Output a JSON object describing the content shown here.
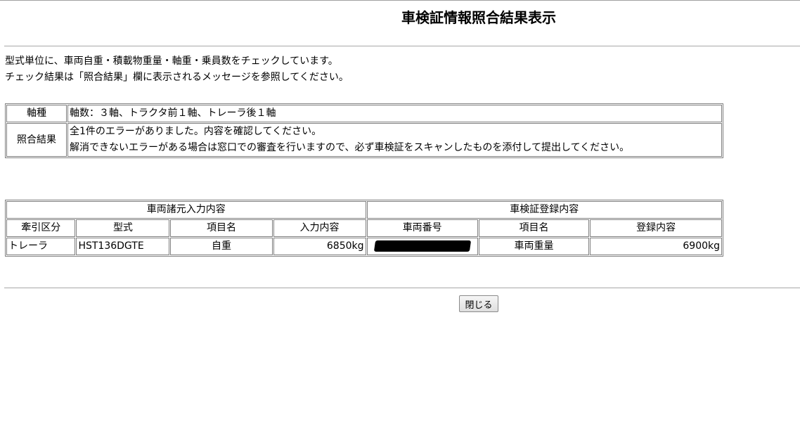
{
  "page": {
    "title": "車検証情報照合結果表示",
    "intro_lines": [
      "型式単位に、車両自重・積載物重量・軸重・乗員数をチェックしています。",
      "チェック結果は「照合結果」欄に表示されるメッセージを参照してください。"
    ]
  },
  "result_table": {
    "axle_label": "軸種",
    "axle_value": "軸数：３軸、トラクタ前１軸、トレーラ後１軸",
    "result_label": "照合結果",
    "result_lines": [
      "全1件のエラーがありました。内容を確認してください。",
      "解消できないエラーがある場合は窓口での審査を行いますので、必ず車検証をスキャンしたものを添付して提出してください。"
    ]
  },
  "vehicle_table": {
    "group_input": "車両諸元入力内容",
    "group_registration": "車検証登録内容",
    "headers": [
      "牽引区分",
      "型式",
      "項目名",
      "入力内容",
      "車両番号",
      "項目名",
      "登録内容"
    ],
    "rows": [
      {
        "towing_type": "トレーラ",
        "model": "HST136DGTE",
        "input_item": "自重",
        "input_value": "6850kg",
        "vehicle_number": "",
        "reg_item": "車両重量",
        "reg_value": "6900kg"
      }
    ]
  },
  "buttons": {
    "close_label": "閉じる"
  }
}
